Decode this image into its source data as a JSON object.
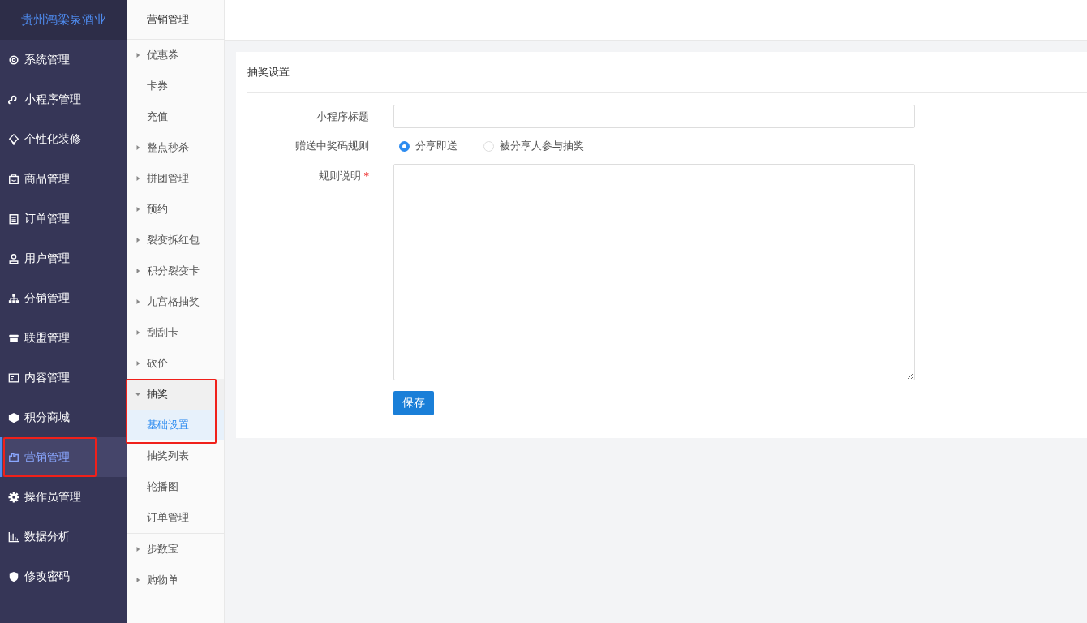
{
  "brand": "贵州鸿梁泉酒业",
  "nav": [
    {
      "label": "系统管理",
      "selected": false,
      "highlighted": false
    },
    {
      "label": "小程序管理",
      "selected": false,
      "highlighted": false
    },
    {
      "label": "个性化装修",
      "selected": false,
      "highlighted": false
    },
    {
      "label": "商品管理",
      "selected": false,
      "highlighted": false
    },
    {
      "label": "订单管理",
      "selected": false,
      "highlighted": false
    },
    {
      "label": "用户管理",
      "selected": false,
      "highlighted": false
    },
    {
      "label": "分销管理",
      "selected": false,
      "highlighted": false
    },
    {
      "label": "联盟管理",
      "selected": false,
      "highlighted": false
    },
    {
      "label": "内容管理",
      "selected": false,
      "highlighted": false
    },
    {
      "label": "积分商城",
      "selected": false,
      "highlighted": false
    },
    {
      "label": "营销管理",
      "selected": true,
      "highlighted": true
    },
    {
      "label": "操作员管理",
      "selected": false,
      "highlighted": false
    },
    {
      "label": "数据分析",
      "selected": false,
      "highlighted": false
    },
    {
      "label": "修改密码",
      "selected": false,
      "highlighted": false
    }
  ],
  "submenu": {
    "title": "营销管理",
    "sections": [
      [
        {
          "kind": "group",
          "label": "优惠券",
          "expanded": false,
          "highlighted": false
        },
        {
          "kind": "link",
          "label": "卡券"
        },
        {
          "kind": "link",
          "label": "充值"
        },
        {
          "kind": "group",
          "label": "整点秒杀",
          "expanded": false,
          "highlighted": false
        },
        {
          "kind": "group",
          "label": "拼团管理",
          "expanded": false,
          "highlighted": false
        },
        {
          "kind": "group",
          "label": "预约",
          "expanded": false,
          "highlighted": false
        },
        {
          "kind": "group",
          "label": "裂变拆红包",
          "expanded": false,
          "highlighted": false
        },
        {
          "kind": "group",
          "label": "积分裂变卡",
          "expanded": false,
          "highlighted": false
        },
        {
          "kind": "group",
          "label": "九宫格抽奖",
          "expanded": false,
          "highlighted": false
        },
        {
          "kind": "group",
          "label": "刮刮卡",
          "expanded": false,
          "highlighted": false
        },
        {
          "kind": "group",
          "label": "砍价",
          "expanded": false,
          "highlighted": false
        },
        {
          "kind": "group",
          "label": "抽奖",
          "expanded": true,
          "highlighted": true,
          "children": [
            {
              "label": "基础设置",
              "selected": true
            },
            {
              "label": "抽奖列表",
              "selected": false
            },
            {
              "label": "轮播图",
              "selected": false
            },
            {
              "label": "订单管理",
              "selected": false
            }
          ]
        }
      ],
      [
        {
          "kind": "group",
          "label": "步数宝",
          "expanded": false,
          "highlighted": false
        },
        {
          "kind": "group",
          "label": "购物单",
          "expanded": false,
          "highlighted": false
        }
      ]
    ]
  },
  "panel": {
    "title": "抽奖设置",
    "fields": [
      {
        "kind": "text",
        "label": "小程序标题"
      },
      {
        "kind": "radio",
        "label": "赠送中奖码规则",
        "options": [
          {
            "label": "分享即送",
            "selected": true
          },
          {
            "label": "被分享人参与抽奖",
            "selected": false
          }
        ]
      },
      {
        "kind": "textarea",
        "label": "规则说明",
        "required_mark": "*"
      }
    ],
    "save_button": "保存"
  }
}
